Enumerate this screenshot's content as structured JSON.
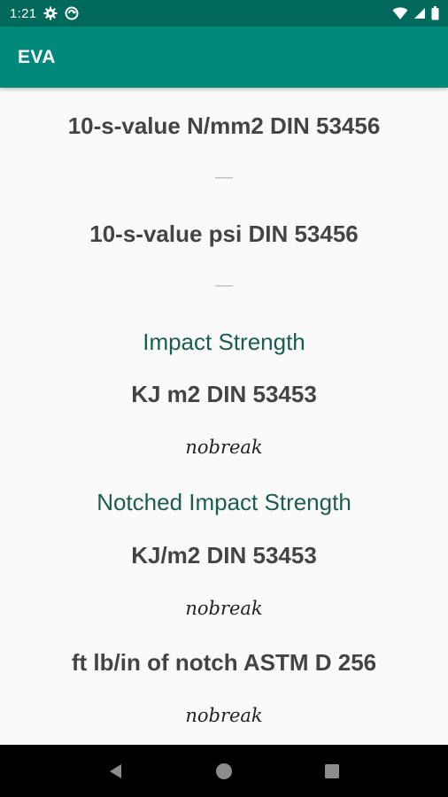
{
  "status_bar": {
    "time": "1:21"
  },
  "app_bar": {
    "title": "EVA"
  },
  "content": {
    "rows": [
      {
        "kind": "label",
        "text": "10-s-value N/mm2 DIN 53456"
      },
      {
        "kind": "value",
        "text": "—"
      },
      {
        "kind": "label",
        "text": "10-s-value psi DIN 53456"
      },
      {
        "kind": "value",
        "text": "—"
      },
      {
        "kind": "heading",
        "text": "Impact Strength"
      },
      {
        "kind": "label",
        "text": "KJ m2 DIN 53453"
      },
      {
        "kind": "value-math",
        "text": "nobreak"
      },
      {
        "kind": "heading",
        "text": "Notched Impact Strength"
      },
      {
        "kind": "label",
        "text": "KJ/m2 DIN 53453"
      },
      {
        "kind": "value-math",
        "text": "nobreak"
      },
      {
        "kind": "label",
        "text": "ft lb/in of notch ASTM D 256"
      },
      {
        "kind": "value-math",
        "text": "nobreak"
      }
    ]
  },
  "colors": {
    "status_bar": "#00695c",
    "app_bar": "#00897b",
    "heading": "#1b5e4f",
    "label": "#444444"
  },
  "icons": {
    "status_left": [
      "gear-icon",
      "sync-icon"
    ],
    "status_right": [
      "wifi-icon",
      "cell-signal-icon",
      "battery-icon"
    ],
    "nav": [
      "back-icon",
      "home-icon",
      "recents-icon"
    ]
  }
}
